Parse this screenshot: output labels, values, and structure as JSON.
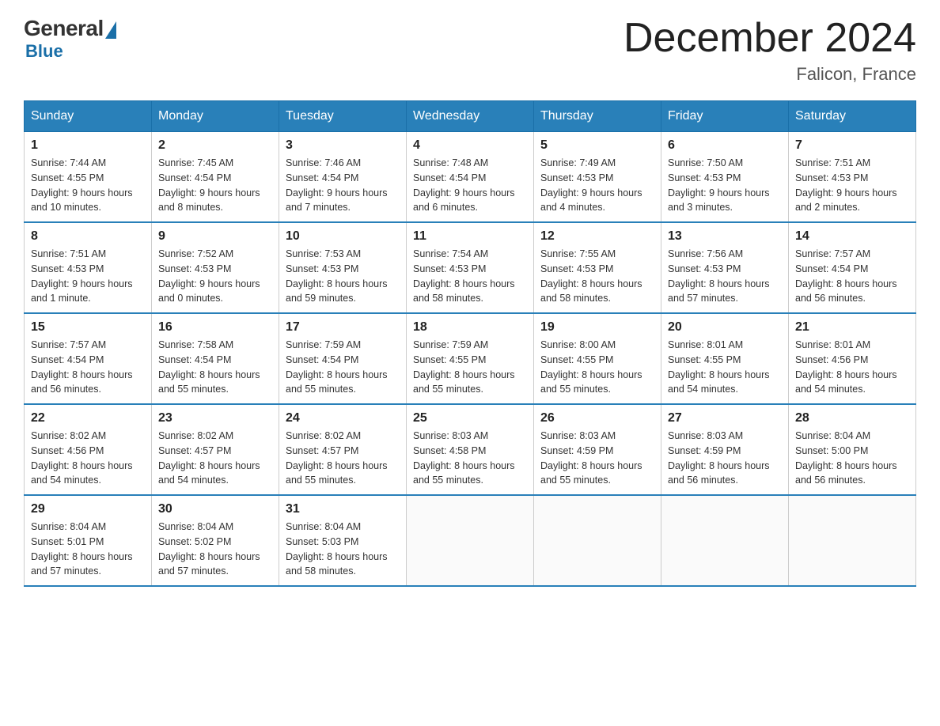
{
  "logo": {
    "general": "General",
    "blue": "Blue"
  },
  "title": {
    "month_year": "December 2024",
    "location": "Falicon, France"
  },
  "weekdays": [
    "Sunday",
    "Monday",
    "Tuesday",
    "Wednesday",
    "Thursday",
    "Friday",
    "Saturday"
  ],
  "weeks": [
    [
      {
        "day": "1",
        "sunrise": "7:44 AM",
        "sunset": "4:55 PM",
        "daylight": "9 hours and 10 minutes."
      },
      {
        "day": "2",
        "sunrise": "7:45 AM",
        "sunset": "4:54 PM",
        "daylight": "9 hours and 8 minutes."
      },
      {
        "day": "3",
        "sunrise": "7:46 AM",
        "sunset": "4:54 PM",
        "daylight": "9 hours and 7 minutes."
      },
      {
        "day": "4",
        "sunrise": "7:48 AM",
        "sunset": "4:54 PM",
        "daylight": "9 hours and 6 minutes."
      },
      {
        "day": "5",
        "sunrise": "7:49 AM",
        "sunset": "4:53 PM",
        "daylight": "9 hours and 4 minutes."
      },
      {
        "day": "6",
        "sunrise": "7:50 AM",
        "sunset": "4:53 PM",
        "daylight": "9 hours and 3 minutes."
      },
      {
        "day": "7",
        "sunrise": "7:51 AM",
        "sunset": "4:53 PM",
        "daylight": "9 hours and 2 minutes."
      }
    ],
    [
      {
        "day": "8",
        "sunrise": "7:51 AM",
        "sunset": "4:53 PM",
        "daylight": "9 hours and 1 minute."
      },
      {
        "day": "9",
        "sunrise": "7:52 AM",
        "sunset": "4:53 PM",
        "daylight": "9 hours and 0 minutes."
      },
      {
        "day": "10",
        "sunrise": "7:53 AM",
        "sunset": "4:53 PM",
        "daylight": "8 hours and 59 minutes."
      },
      {
        "day": "11",
        "sunrise": "7:54 AM",
        "sunset": "4:53 PM",
        "daylight": "8 hours and 58 minutes."
      },
      {
        "day": "12",
        "sunrise": "7:55 AM",
        "sunset": "4:53 PM",
        "daylight": "8 hours and 58 minutes."
      },
      {
        "day": "13",
        "sunrise": "7:56 AM",
        "sunset": "4:53 PM",
        "daylight": "8 hours and 57 minutes."
      },
      {
        "day": "14",
        "sunrise": "7:57 AM",
        "sunset": "4:54 PM",
        "daylight": "8 hours and 56 minutes."
      }
    ],
    [
      {
        "day": "15",
        "sunrise": "7:57 AM",
        "sunset": "4:54 PM",
        "daylight": "8 hours and 56 minutes."
      },
      {
        "day": "16",
        "sunrise": "7:58 AM",
        "sunset": "4:54 PM",
        "daylight": "8 hours and 55 minutes."
      },
      {
        "day": "17",
        "sunrise": "7:59 AM",
        "sunset": "4:54 PM",
        "daylight": "8 hours and 55 minutes."
      },
      {
        "day": "18",
        "sunrise": "7:59 AM",
        "sunset": "4:55 PM",
        "daylight": "8 hours and 55 minutes."
      },
      {
        "day": "19",
        "sunrise": "8:00 AM",
        "sunset": "4:55 PM",
        "daylight": "8 hours and 55 minutes."
      },
      {
        "day": "20",
        "sunrise": "8:01 AM",
        "sunset": "4:55 PM",
        "daylight": "8 hours and 54 minutes."
      },
      {
        "day": "21",
        "sunrise": "8:01 AM",
        "sunset": "4:56 PM",
        "daylight": "8 hours and 54 minutes."
      }
    ],
    [
      {
        "day": "22",
        "sunrise": "8:02 AM",
        "sunset": "4:56 PM",
        "daylight": "8 hours and 54 minutes."
      },
      {
        "day": "23",
        "sunrise": "8:02 AM",
        "sunset": "4:57 PM",
        "daylight": "8 hours and 54 minutes."
      },
      {
        "day": "24",
        "sunrise": "8:02 AM",
        "sunset": "4:57 PM",
        "daylight": "8 hours and 55 minutes."
      },
      {
        "day": "25",
        "sunrise": "8:03 AM",
        "sunset": "4:58 PM",
        "daylight": "8 hours and 55 minutes."
      },
      {
        "day": "26",
        "sunrise": "8:03 AM",
        "sunset": "4:59 PM",
        "daylight": "8 hours and 55 minutes."
      },
      {
        "day": "27",
        "sunrise": "8:03 AM",
        "sunset": "4:59 PM",
        "daylight": "8 hours and 56 minutes."
      },
      {
        "day": "28",
        "sunrise": "8:04 AM",
        "sunset": "5:00 PM",
        "daylight": "8 hours and 56 minutes."
      }
    ],
    [
      {
        "day": "29",
        "sunrise": "8:04 AM",
        "sunset": "5:01 PM",
        "daylight": "8 hours and 57 minutes."
      },
      {
        "day": "30",
        "sunrise": "8:04 AM",
        "sunset": "5:02 PM",
        "daylight": "8 hours and 57 minutes."
      },
      {
        "day": "31",
        "sunrise": "8:04 AM",
        "sunset": "5:03 PM",
        "daylight": "8 hours and 58 minutes."
      },
      null,
      null,
      null,
      null
    ]
  ],
  "labels": {
    "sunrise": "Sunrise:",
    "sunset": "Sunset:",
    "daylight": "Daylight:"
  }
}
